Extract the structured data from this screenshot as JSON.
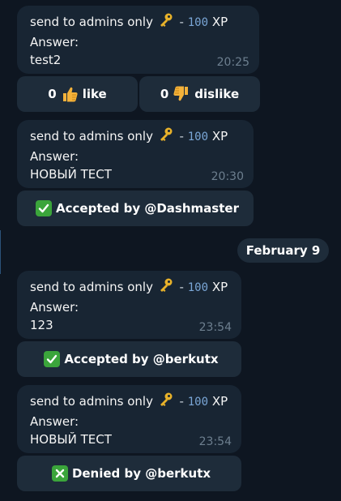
{
  "messages": [
    {
      "title": "send to admins only",
      "separator": "-",
      "xp_value": "100",
      "xp_unit": "XP",
      "answer_label": "Answer:",
      "answer": "test2",
      "time": "20:25",
      "key_icon": "key-icon"
    },
    {
      "title": "send to admins only",
      "separator": "-",
      "xp_value": "100",
      "xp_unit": "XP",
      "answer_label": "Answer:",
      "answer": "НОВЫЙ ТЕСТ",
      "time": "20:30",
      "key_icon": "key-icon",
      "status": "Accepted by @Dashmaster",
      "status_icon": "check-mark-icon"
    },
    {
      "title": "send to admins only",
      "separator": "-",
      "xp_value": "100",
      "xp_unit": "XP",
      "answer_label": "Answer:",
      "answer": "123",
      "time": "23:54",
      "key_icon": "key-icon",
      "status": "Accepted by @berkutx",
      "status_icon": "check-mark-icon"
    },
    {
      "title": "send to admins only",
      "separator": "-",
      "xp_value": "100",
      "xp_unit": "XP",
      "answer_label": "Answer:",
      "answer": "НОВЫЙ ТЕСТ",
      "time": "23:54",
      "key_icon": "key-icon",
      "status": "Denied by @berkutx",
      "status_icon": "cross-mark-icon"
    }
  ],
  "reactions": {
    "like_count": "0",
    "like_label": "like",
    "like_icon": "thumbs-up-icon",
    "dislike_count": "0",
    "dislike_label": "dislike",
    "dislike_icon": "thumbs-down-icon"
  },
  "date_separator": "February 9",
  "colors": {
    "background": "#0e1621",
    "bubble": "#182533",
    "button": "#1e2c3a",
    "xp_accent": "#7aa6d6",
    "time": "#6d7f8f",
    "check_green": "#3ba53b",
    "key_gold": "#e8b22a"
  }
}
